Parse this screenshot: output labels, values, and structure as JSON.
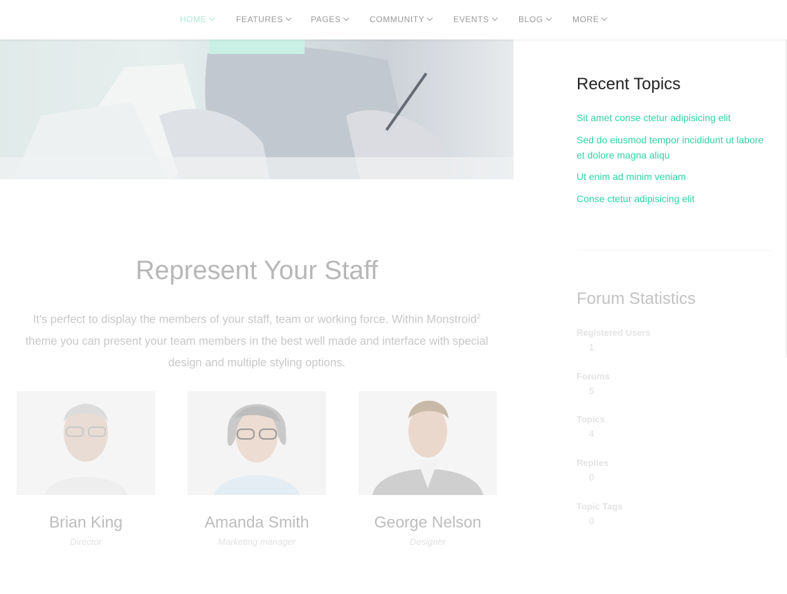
{
  "nav": {
    "items": [
      {
        "label": "HOME",
        "active": true
      },
      {
        "label": "FEATURES"
      },
      {
        "label": "PAGES"
      },
      {
        "label": "COMMUNITY"
      },
      {
        "label": "EVENTS"
      },
      {
        "label": "BLOG"
      },
      {
        "label": "MORE"
      }
    ]
  },
  "staff_section": {
    "title": "Represent Your Staff",
    "desc_part1": "It's perfect to display the members of your staff, team or working force. Within Monstroid",
    "desc_sup": "2",
    "desc_part2": " theme you can present your team members in the best well made and interface with special design and multiple styling options.",
    "members": [
      {
        "name": "Brian King",
        "role": "Director"
      },
      {
        "name": "Amanda Smith",
        "role": "Marketing manager"
      },
      {
        "name": "George Nelson",
        "role": "Designer"
      }
    ]
  },
  "sidebar": {
    "recent_topics": {
      "title": "Recent Topics",
      "items": [
        "Sit amet conse ctetur adipisicing elit",
        "Sed do eiusmod tempor incididunt ut labore et dolore magna aliqu",
        "Ut enim ad minim veniam",
        "Conse ctetur adipisicing elit"
      ]
    },
    "forum_stats": {
      "title": "Forum Statistics",
      "stats": [
        {
          "label": "Registered Users",
          "value": "1"
        },
        {
          "label": "Forums",
          "value": "5"
        },
        {
          "label": "Topics",
          "value": "4"
        },
        {
          "label": "Replies",
          "value": "0"
        },
        {
          "label": "Topic Tags",
          "value": "0"
        }
      ]
    }
  },
  "colors": {
    "accent": "#2fd3a5",
    "nav_active": "#aee8d7"
  }
}
